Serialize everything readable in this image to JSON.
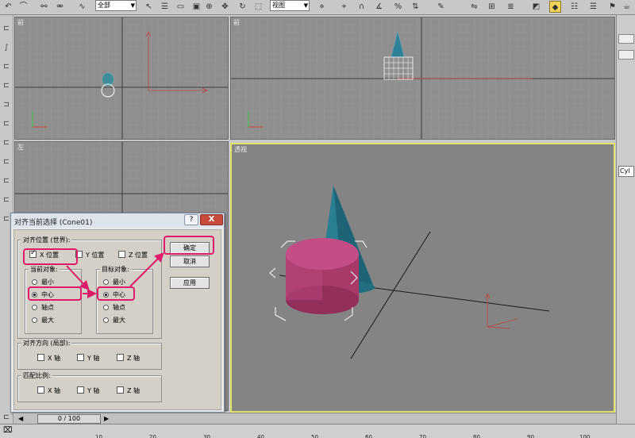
{
  "toolbar": {
    "selection_filter": "全部",
    "reference_coord": "视图"
  },
  "viewports": {
    "front": "前",
    "top_right": "前",
    "left": "左",
    "perspective": "透视"
  },
  "dialog": {
    "title": "对齐当前选择 (Cone01)",
    "help_label": "?",
    "close_label": "X",
    "position_group": "对齐位置 (世界):",
    "x_pos": "X 位置",
    "y_pos": "Y 位置",
    "z_pos": "Z 位置",
    "current_object": "当前对象:",
    "target_object": "目标对象:",
    "opt_min": "最小",
    "opt_center": "中心",
    "opt_pivot": "轴点",
    "opt_max": "最大",
    "orientation_group": "对齐方向 (局部):",
    "scale_group": "匹配比例:",
    "x_axis": "X 轴",
    "y_axis": "Y 轴",
    "z_axis": "Z 轴",
    "ok_label": "确定",
    "cancel_label": "取消",
    "apply_label": "应用"
  },
  "right_panel": {
    "name_field": "Cyl"
  },
  "timeline": {
    "frame": "0 / 100"
  },
  "ruler_ticks": [
    "10",
    "20",
    "30",
    "40",
    "50",
    "60",
    "70",
    "80",
    "90",
    "100"
  ]
}
